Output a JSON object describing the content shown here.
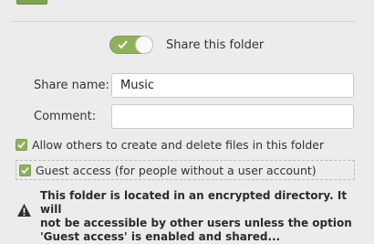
{
  "share": {
    "enabled": true,
    "label": "Share this folder"
  },
  "form": {
    "share_name_label": "Share name:",
    "share_name_value": "Music",
    "comment_label": "Comment:",
    "comment_value": ""
  },
  "options": {
    "allow_others_label": "Allow others to create and delete files in this folder",
    "allow_others_checked": true,
    "guest_access_label": "Guest access (for people without a user account)",
    "guest_access_checked": true
  },
  "warning": {
    "line1": "This folder is located in an encrypted directory. It will",
    "line2": "not be accessible by other users unless the option",
    "line3": "'Guest access' is enabled and shared..."
  },
  "colors": {
    "accent": "#8fb15d",
    "background": "#ececec"
  },
  "icons": {
    "warning": "warning-triangle-icon",
    "check": "check-icon"
  }
}
